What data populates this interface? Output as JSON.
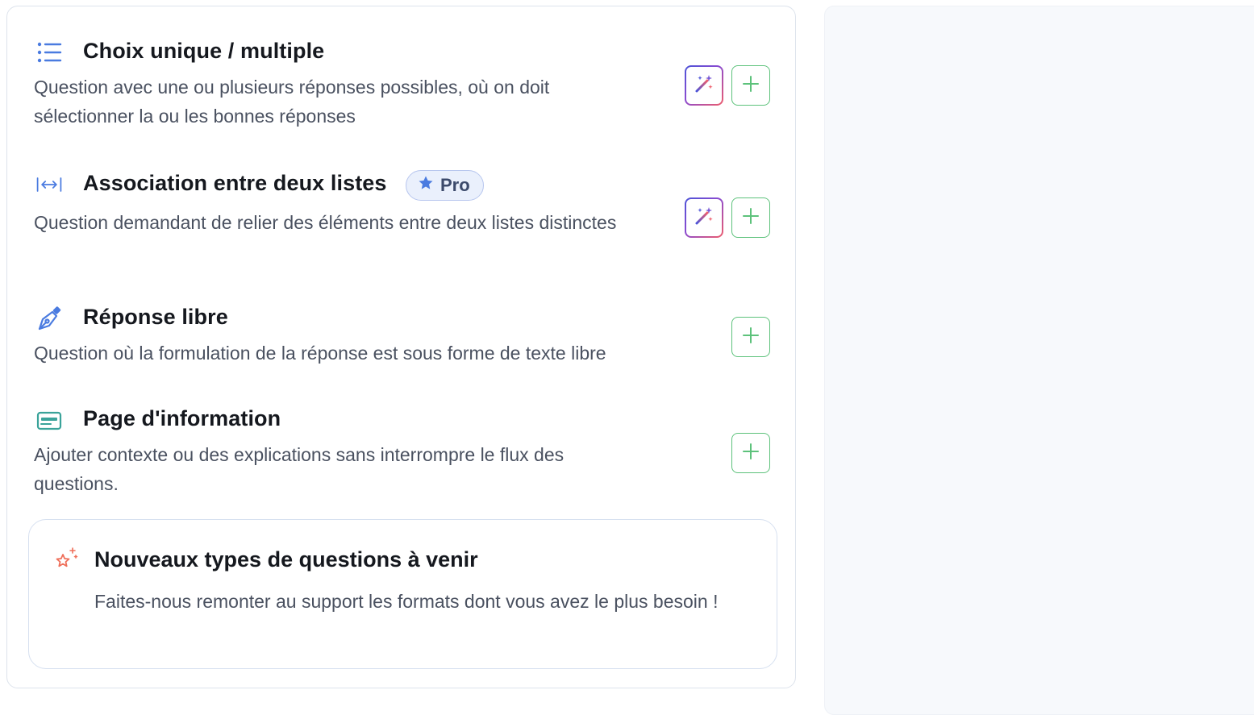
{
  "question_types": [
    {
      "title": "Choix unique / multiple",
      "description": "Question avec une ou plusieurs réponses possibles, où on doit sélectionner la ou les bonnes réponses",
      "icon": "list-icon",
      "has_ai_button": true
    },
    {
      "title": "Association entre deux listes",
      "badge": "Pro",
      "description": "Question demandant de relier des éléments entre deux listes distinctes",
      "icon": "arrows-horizontal-icon",
      "has_ai_button": true
    },
    {
      "title": "Réponse libre",
      "description": "Question où la formulation de la réponse est sous forme de texte libre",
      "icon": "pen-icon",
      "has_ai_button": false
    },
    {
      "title": "Page d'information",
      "description": "Ajouter contexte ou des explications sans interrompre le flux des questions.",
      "icon": "card-icon",
      "has_ai_button": false
    }
  ],
  "upcoming": {
    "title": "Nouveaux types de questions à venir",
    "description": "Faites-nous remonter au support les formats dont vous avez le plus besoin !",
    "icon": "sparkle-star-icon"
  },
  "colors": {
    "accent_green": "#5dc27b",
    "accent_blue": "#4a7be0",
    "badge_bg": "#eaf0fc",
    "ai_gradient": [
      "#4c54d8",
      "#ef5d6c"
    ],
    "sparkle": "#ef6f5a"
  }
}
